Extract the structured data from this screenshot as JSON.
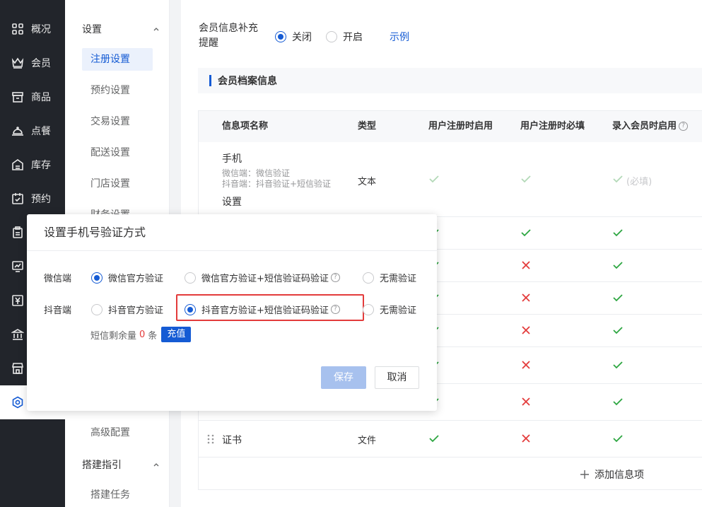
{
  "nav_primary": [
    {
      "label": "概况",
      "icon": "grid-icon"
    },
    {
      "label": "会员",
      "icon": "crown-icon"
    },
    {
      "label": "商品",
      "icon": "shop-icon"
    },
    {
      "label": "点餐",
      "icon": "dish-cover-icon"
    },
    {
      "label": "库存",
      "icon": "warehouse-icon"
    },
    {
      "label": "预约",
      "icon": "calendar-check-icon"
    },
    {
      "label": "",
      "icon": "clipboard-icon"
    },
    {
      "label": "",
      "icon": "chart-screen-icon"
    },
    {
      "label": "",
      "icon": "yen-icon"
    },
    {
      "label": "",
      "icon": "bank-icon"
    },
    {
      "label": "",
      "icon": "store-icon"
    },
    {
      "label": "",
      "icon": "settings-gear-icon"
    }
  ],
  "nav_secondary": {
    "group_settings": "设置",
    "items": [
      "注册设置",
      "预约设置",
      "交易设置",
      "配送设置",
      "门店设置",
      "财务设置"
    ],
    "item_advanced": "高级配置",
    "group_guide": "搭建指引",
    "item_task": "搭建任务"
  },
  "remind": {
    "label": "会员信息补充提醒",
    "option_off": "关闭",
    "option_on": "开启",
    "example_link": "示例"
  },
  "section_title": "会员档案信息",
  "table": {
    "headers": [
      "信息项名称",
      "类型",
      "用户注册时启用",
      "用户注册时必填",
      "录入会员时启用"
    ],
    "phone_row": {
      "name": "手机",
      "sub1": "微信端：微信验证",
      "sub2": "抖音端：抖音验证+短信验证",
      "link": "设置",
      "type": "文本",
      "required_note": "(必填)"
    },
    "rows": [
      {
        "enable": true,
        "required": true,
        "entry": true
      },
      {
        "enable": true,
        "required": false,
        "entry": true
      },
      {
        "enable": true,
        "required": false,
        "entry": true
      },
      {
        "enable": true,
        "required": false,
        "entry": true
      },
      {
        "enable": true,
        "required": false,
        "entry": true
      },
      {
        "enable": true,
        "required": false,
        "entry": true
      }
    ],
    "last_row": {
      "name": "证书",
      "type": "文件"
    },
    "add_label": "添加信息项"
  },
  "modal": {
    "title": "设置手机号验证方式",
    "wechat_label": "微信端",
    "wechat_options": [
      "微信官方验证",
      "微信官方验证+短信验证码验证",
      "无需验证"
    ],
    "douyin_label": "抖音端",
    "douyin_options": [
      "抖音官方验证",
      "抖音官方验证+短信验证码验证",
      "无需验证"
    ],
    "sms_prefix": "短信剩余量",
    "sms_count": "0",
    "sms_unit": "条",
    "recharge": "充值",
    "save": "保存",
    "cancel": "取消"
  },
  "colors": {
    "primary": "#155bd4",
    "check": "#2da641",
    "cross": "#e33b3b",
    "nav_bg": "#22252b"
  }
}
